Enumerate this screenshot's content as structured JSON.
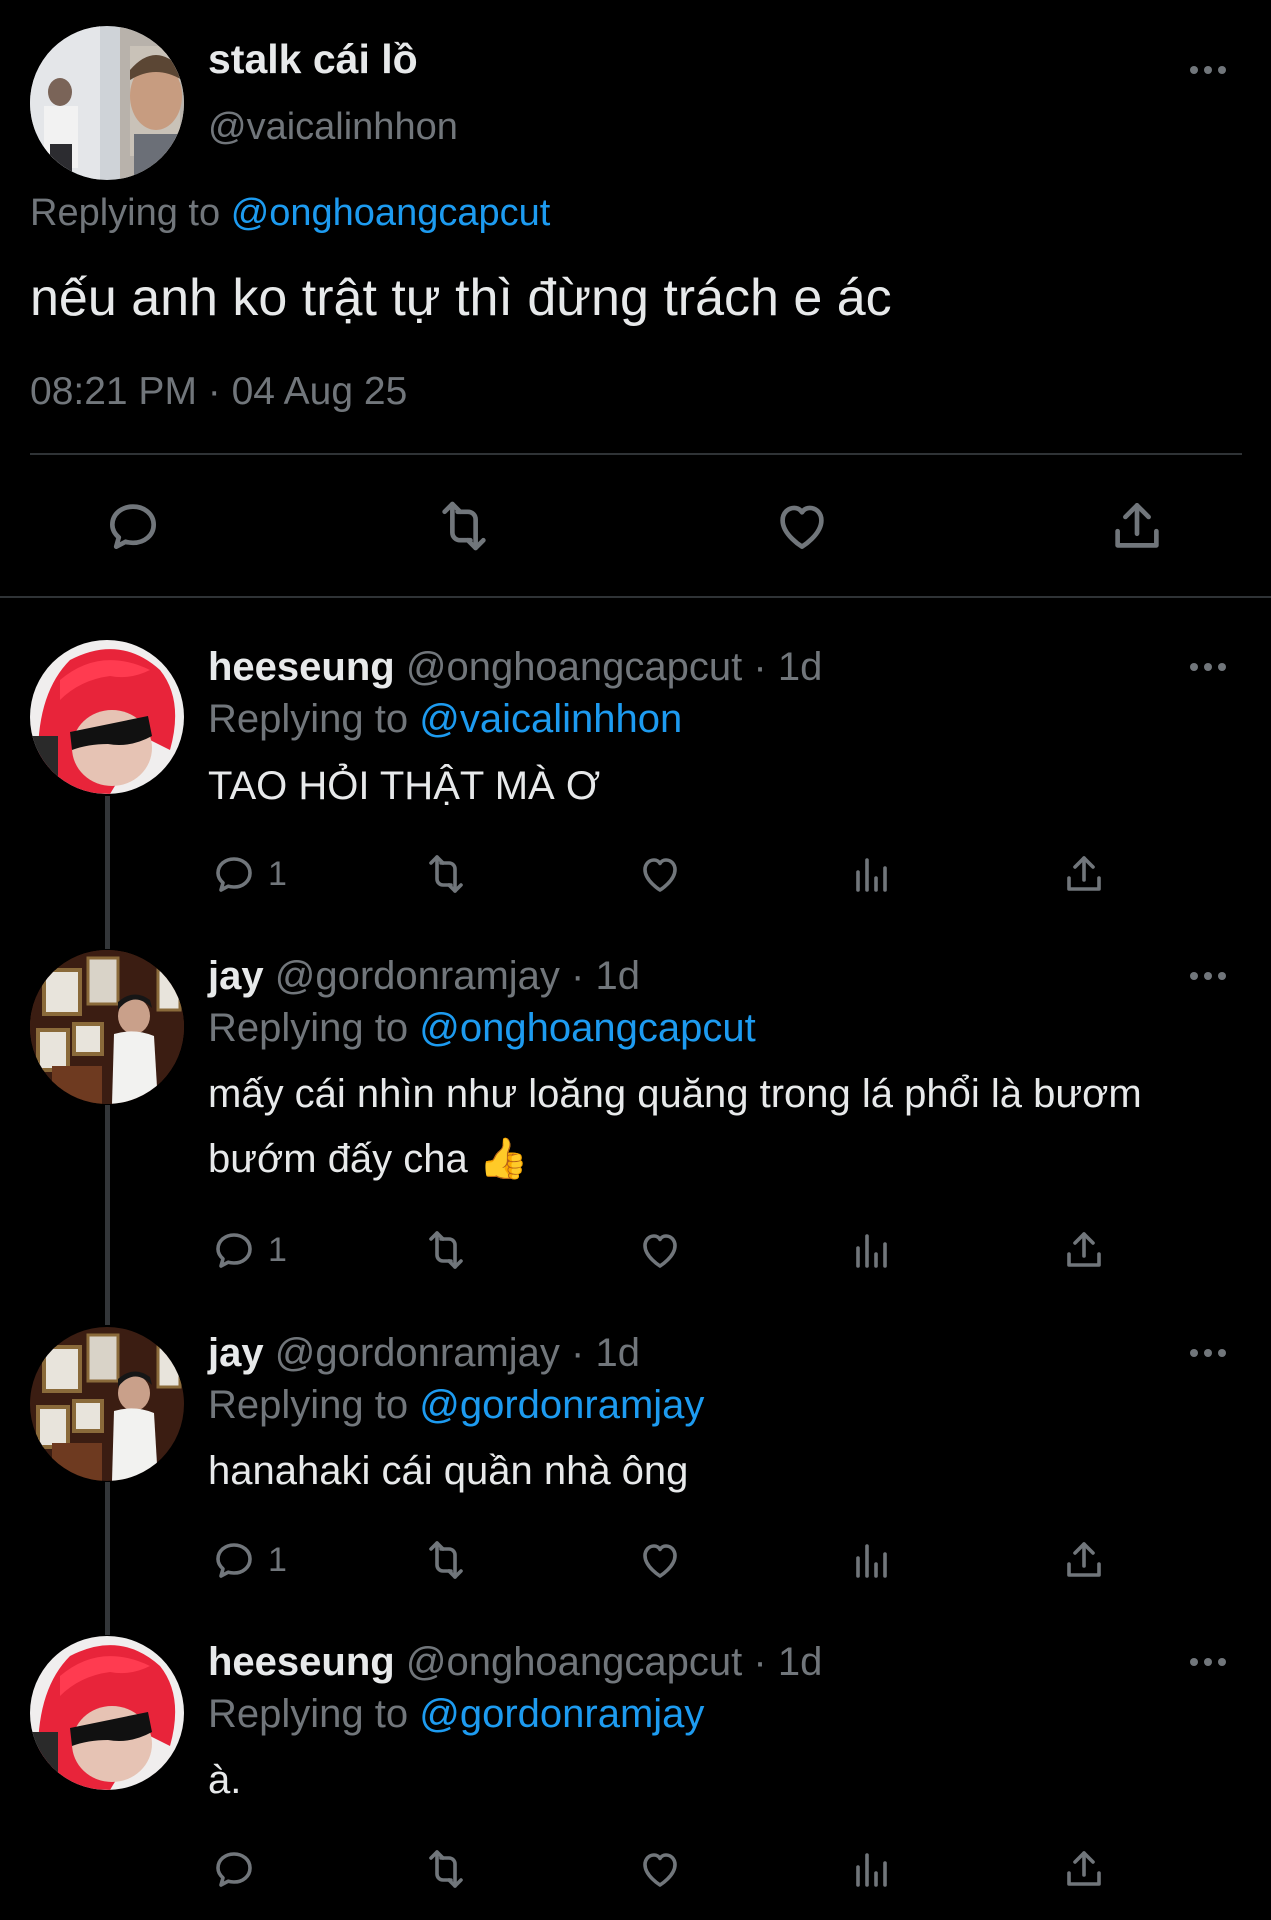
{
  "main_tweet": {
    "author_name": "stalk cái lồ",
    "author_handle": "@vaicalinhhon",
    "replying_prefix": "Replying to",
    "replying_to": "@onghoangcapcut",
    "text": "nếu anh ko trật tự thì đừng trách e ác",
    "timestamp": "08:21 PM · 04 Aug 25",
    "actions": [
      "reply-icon",
      "retweet-icon",
      "like-icon",
      "share-icon"
    ]
  },
  "replies": [
    {
      "name": "heeseung",
      "handle": "@onghoangcapcut · 1d",
      "replying_prefix": "Replying to",
      "replying_to": "@vaicalinhhon",
      "text": "TAO HỎI THẬT MÀ Ơ",
      "reply_count": "1"
    },
    {
      "name": "jay",
      "handle": "@gordonramjay · 1d",
      "replying_prefix": "Replying to",
      "replying_to": "@onghoangcapcut",
      "text": "mấy cái nhìn như loăng quăng trong lá phổi là bươm bướm đấy cha 👍",
      "reply_count": "1"
    },
    {
      "name": "jay",
      "handle": "@gordonramjay · 1d",
      "replying_prefix": "Replying to",
      "replying_to": "@gordonramjay",
      "text": "hanahaki cái quần nhà ông",
      "reply_count": "1"
    },
    {
      "name": "heeseung",
      "handle": "@onghoangcapcut · 1d",
      "replying_prefix": "Replying to",
      "replying_to": "@gordonramjay",
      "text": "à.",
      "reply_count": ""
    }
  ],
  "colors": {
    "background": "#000000",
    "text_primary": "#e7e9ea",
    "text_secondary": "#71767b",
    "link": "#1d9bf0",
    "divider": "#2f3336"
  }
}
